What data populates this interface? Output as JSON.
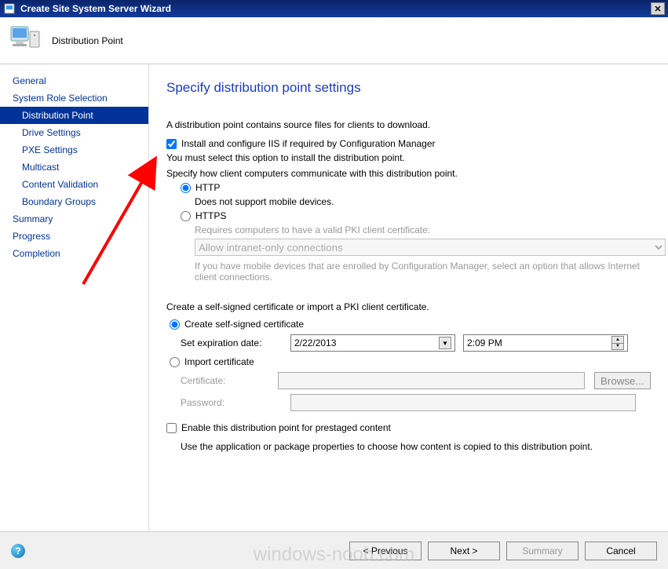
{
  "window": {
    "title": "Create Site System Server Wizard"
  },
  "header": {
    "title": "Distribution Point"
  },
  "sidebar": {
    "items": [
      {
        "label": "General",
        "child": false
      },
      {
        "label": "System Role Selection",
        "child": false
      },
      {
        "label": "Distribution Point",
        "child": true,
        "selected": true
      },
      {
        "label": "Drive Settings",
        "child": true
      },
      {
        "label": "PXE Settings",
        "child": true
      },
      {
        "label": "Multicast",
        "child": true
      },
      {
        "label": "Content Validation",
        "child": true
      },
      {
        "label": "Boundary Groups",
        "child": true
      },
      {
        "label": "Summary",
        "child": false
      },
      {
        "label": "Progress",
        "child": false
      },
      {
        "label": "Completion",
        "child": false
      }
    ]
  },
  "main": {
    "title": "Specify distribution point settings",
    "desc": "A distribution point contains source files for clients to download.",
    "iis_checkbox": "Install and configure IIS if required by Configuration Manager",
    "iis_note": "You must select this option to install the distribution point.",
    "comm_label": "Specify how client computers communicate with this distribution point.",
    "http_label": "HTTP",
    "http_note": "Does not support mobile devices.",
    "https_label": "HTTPS",
    "https_note": "Requires computers to have a valid PKI client certificate:",
    "https_dropdown": "Allow intranet-only connections",
    "https_footer": "If you have mobile devices that are enrolled by Configuration Manager, select an option that allows Internet client connections.",
    "cert_section": "Create a self-signed certificate or import a PKI client certificate.",
    "create_cert": "Create self-signed certificate",
    "exp_label": "Set expiration date:",
    "exp_date": "2/22/2013",
    "exp_time": "2:09 PM",
    "import_cert": "Import certificate",
    "cert_field": "Certificate:",
    "pass_field": "Password:",
    "browse": "Browse...",
    "prestage": "Enable this distribution point for prestaged content",
    "prestage_note": "Use the application or package properties to choose how content is copied to this distribution point."
  },
  "footer": {
    "previous": "< Previous",
    "next": "Next >",
    "summary": "Summary",
    "cancel": "Cancel"
  },
  "watermark": "windows-noob.com"
}
